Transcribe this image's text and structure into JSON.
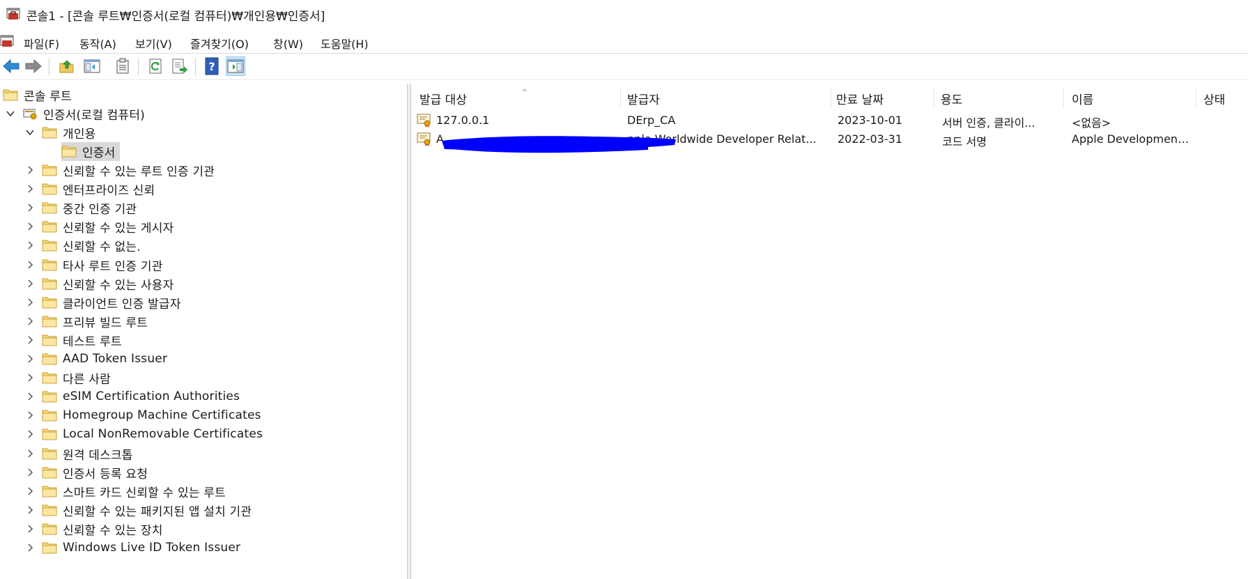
{
  "window": {
    "title": "콘솔1 - [콘솔 루트₩인증서(로컬 컴퓨터)₩개인용₩인증서]"
  },
  "menu": [
    "파일(F)",
    "동작(A)",
    "보기(V)",
    "즐겨찾기(O)",
    "창(W)",
    "도움말(H)"
  ],
  "toolbar": {
    "buttons": [
      "back-arrow-icon",
      "forward-arrow-icon",
      "up-folder-icon",
      "show-hide-console-tree-icon",
      "properties-clipboard-icon",
      "refresh-icon",
      "export-list-icon",
      "help-icon",
      "show-hide-action-pane-icon"
    ]
  },
  "tree": {
    "root": "콘솔 루트",
    "computer": "인증서(로컬 컴퓨터)",
    "personal": "개인용",
    "certificates": "인증서",
    "stores": [
      "신뢰할 수 있는 루트 인증 기관",
      "엔터프라이즈 신뢰",
      "중간 인증 기관",
      "신뢰할 수 있는 게시자",
      "신뢰할 수 없는.",
      "타사 루트 인증 기관",
      "신뢰할 수 있는 사용자",
      "클라이언트 인증 발급자",
      "프리뷰 빌드 루트",
      "테스트 루트",
      "AAD Token Issuer",
      "다른 사람",
      "eSIM Certification Authorities",
      "Homegroup Machine Certificates",
      "Local NonRemovable Certificates",
      "원격 데스크톱",
      "인증서 등록 요청",
      "스마트 카드 신뢰할 수 있는 루트",
      "신뢰할 수 있는 패키지된 앱 설치 기관",
      "신뢰할 수 있는 장치",
      "Windows Live ID Token Issuer"
    ]
  },
  "list": {
    "columns": [
      "발급 대상",
      "발급자",
      "만료 날짜",
      "용도",
      "이름",
      "상태"
    ],
    "rows": [
      {
        "issued_to": "127.0.0.1",
        "issued_by": "DErp_CA",
        "expires": "2023-10-01",
        "purpose": "서버 인증, 클라이...",
        "name": "<없음>",
        "status": ""
      },
      {
        "issued_to": "A",
        "issued_by": "pple Worldwide Developer Relat...",
        "expires": "2022-03-31",
        "purpose": "코드 서명",
        "name": "Apple Development...",
        "status": ""
      }
    ]
  },
  "colors": {
    "selection": "#d9d9d9",
    "toolbar_active": "#cce4f7",
    "redaction": "#0000ff"
  }
}
